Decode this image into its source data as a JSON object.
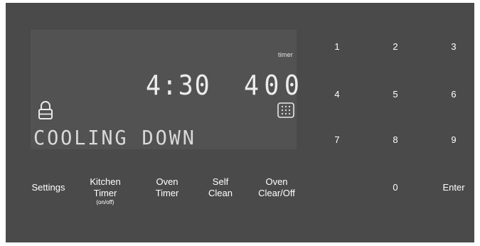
{
  "display": {
    "timer_label": "timer",
    "clock": "4:30",
    "temperature": "400",
    "status": "COOLING DOWN",
    "icons": [
      "lock-icon",
      "oven-rack-icon"
    ]
  },
  "function_keys": [
    {
      "label": "Settings",
      "sub": ""
    },
    {
      "label": "Kitchen\nTimer",
      "sub": "(on/off)"
    },
    {
      "label": "Oven\nTimer",
      "sub": ""
    },
    {
      "label": "Self\nClean",
      "sub": ""
    },
    {
      "label": "Oven\nClear/Off",
      "sub": ""
    }
  ],
  "keypad": {
    "k1": "1",
    "k2": "2",
    "k3": "3",
    "k4": "4",
    "k5": "5",
    "k6": "6",
    "k7": "7",
    "k8": "8",
    "k9": "9",
    "k0": "0",
    "enter": "Enter"
  },
  "colors": {
    "panel": "#4a4a4a",
    "display": "#525252",
    "text": "#ffffff"
  }
}
